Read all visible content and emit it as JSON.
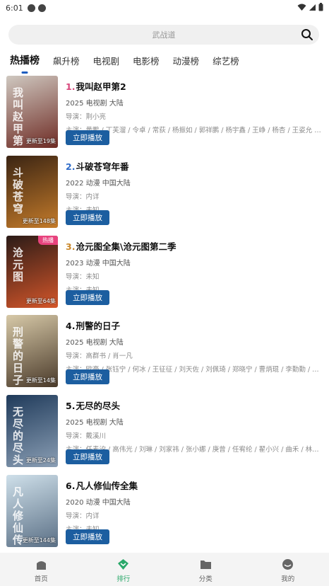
{
  "status_bar": {
    "time": "6:01"
  },
  "search": {
    "placeholder": "武战道"
  },
  "tabs": [
    {
      "label": "热播榜",
      "active": true
    },
    {
      "label": "飙升榜",
      "active": false
    },
    {
      "label": "电视剧",
      "active": false
    },
    {
      "label": "电影榜",
      "active": false
    },
    {
      "label": "动漫榜",
      "active": false
    },
    {
      "label": "综艺榜",
      "active": false
    }
  ],
  "items": [
    {
      "rank": "1.",
      "rank_color": "#d8477c",
      "title": "我叫赵甲第2",
      "meta": "2025 电视剧 大陆",
      "director": "导演：荆小亮",
      "cast": "主演：黄鹏 / 丁芙溜 / 令卓 / 常荻 / 杨振如 / 郭祥鹏 / 杨宇鑫 / 王峥 / 杨杏 / 王姿允 / 赵龙...",
      "episodes": "更新至19集",
      "hot_badge": "",
      "poster_text": "我叫赵甲第",
      "poster_colors": [
        "#cfc8c0",
        "#6e2b24"
      ],
      "play_label": "立即播放"
    },
    {
      "rank": "2.",
      "rank_color": "#2f6cc9",
      "title": "斗破苍穹年番",
      "meta": "2022 动漫 中国大陆",
      "director": "导演：内详",
      "cast": "主演：未知",
      "episodes": "更新至148集",
      "hot_badge": "",
      "poster_text": "斗破苍穹",
      "poster_colors": [
        "#3a2413",
        "#c47b2a"
      ],
      "play_label": "立即播放"
    },
    {
      "rank": "3.",
      "rank_color": "#c9882b",
      "title": "沧元图全集\\沧元图第二季",
      "meta": "2023 动漫 中国大陆",
      "director": "导演：未知",
      "cast": "主演：未知",
      "episodes": "更新至64集",
      "hot_badge": "热播",
      "poster_text": "沧元图",
      "poster_colors": [
        "#2b1b17",
        "#d4562a"
      ],
      "play_label": "立即播放"
    },
    {
      "rank": "4.",
      "rank_color": "#111111",
      "title": "刑警的日子",
      "meta": "2025 电视剧 大陆",
      "director": "导演：高群书 / 肖一凡",
      "cast": "主演：欧豪 / 张钰宁 / 何冰 / 王征征 / 刘天佐 / 刘佩琦 / 郑晓宁 / 曹炳琨 / 李勤勤 / 艾丽...",
      "episodes": "更新至14集",
      "hot_badge": "",
      "poster_text": "刑警的日子",
      "poster_colors": [
        "#d7c9a8",
        "#4a3a2a"
      ],
      "play_label": "立即播放"
    },
    {
      "rank": "5.",
      "rank_color": "#111111",
      "title": "无尽的尽头",
      "meta": "2025 电视剧 大陆",
      "director": "导演：戴溪川",
      "cast": "主演：任素汐 / 高伟光 / 刘琳 / 刘家祎 / 张小娜 / 庚曾 / 任宥纶 / 翟小兴 / 曲禾 / 林鹏 / 霍...",
      "episodes": "更新至24集",
      "hot_badge": "",
      "poster_text": "无尽的尽头",
      "poster_colors": [
        "#1f3a5a",
        "#8b9fb5"
      ],
      "play_label": "立即播放"
    },
    {
      "rank": "6.",
      "rank_color": "#111111",
      "title": "凡人修仙传全集",
      "meta": "2020 动漫 中国大陆",
      "director": "导演：内详",
      "cast": "主演：未知",
      "episodes": "更新至144集",
      "hot_badge": "",
      "poster_text": "凡人修仙传",
      "poster_colors": [
        "#cfe0ea",
        "#5a6f85"
      ],
      "play_label": "立即播放"
    }
  ],
  "bottom_nav": [
    {
      "label": "首页",
      "icon": "home-icon",
      "active": false
    },
    {
      "label": "排行",
      "icon": "ranking-icon",
      "active": true
    },
    {
      "label": "分类",
      "icon": "folder-icon",
      "active": false
    },
    {
      "label": "我的",
      "icon": "profile-icon",
      "active": false
    }
  ],
  "colors": {
    "accent": "#1c5ea0",
    "active_nav": "#2aa86a",
    "tab_underline": "#1e5dbf"
  }
}
